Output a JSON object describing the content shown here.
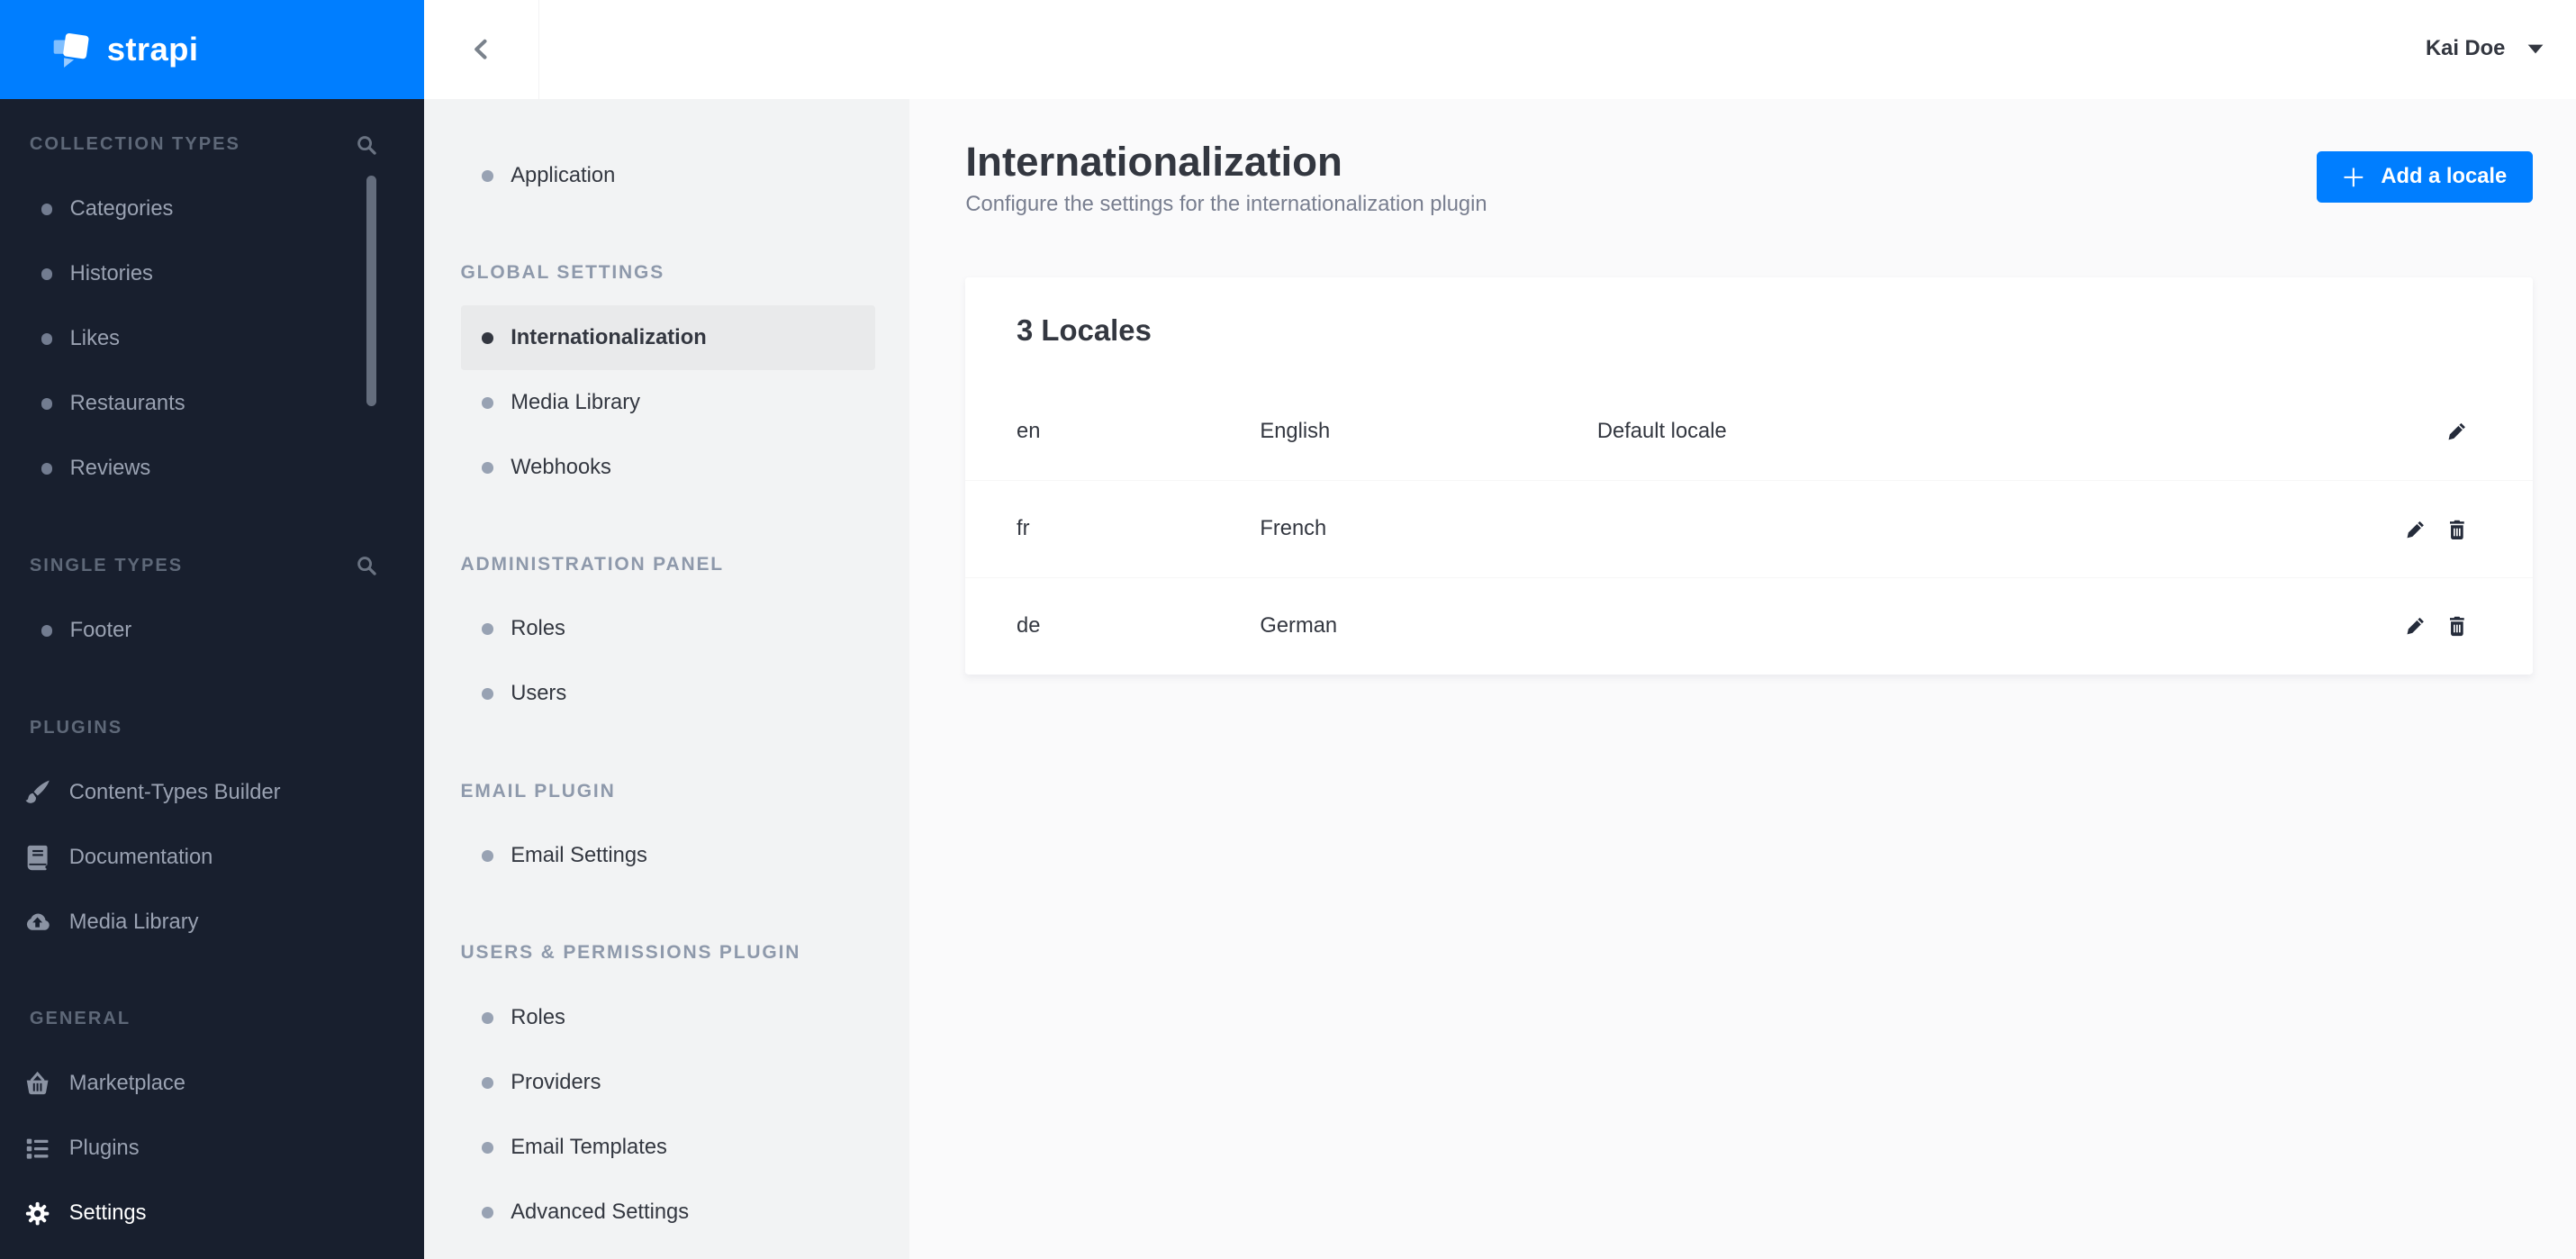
{
  "logo_text": "strapi",
  "user": {
    "name": "Kai Doe"
  },
  "sidebar": {
    "sections": [
      {
        "label": "COLLECTION TYPES",
        "search": true,
        "items": [
          {
            "label": "Categories"
          },
          {
            "label": "Histories"
          },
          {
            "label": "Likes"
          },
          {
            "label": "Restaurants"
          },
          {
            "label": "Reviews"
          }
        ]
      },
      {
        "label": "SINGLE TYPES",
        "search": true,
        "items": [
          {
            "label": "Footer"
          }
        ]
      },
      {
        "label": "PLUGINS",
        "items": [
          {
            "label": "Content-Types Builder",
            "icon": "paint-brush"
          },
          {
            "label": "Documentation",
            "icon": "book"
          },
          {
            "label": "Media Library",
            "icon": "cloud-upload"
          }
        ]
      },
      {
        "label": "GENERAL",
        "items": [
          {
            "label": "Marketplace",
            "icon": "shopping-basket"
          },
          {
            "label": "Plugins",
            "icon": "list"
          },
          {
            "label": "Settings",
            "icon": "gear",
            "active": true
          }
        ]
      }
    ]
  },
  "settings_nav": {
    "groups": [
      {
        "header": "",
        "items": [
          {
            "label": "Application"
          }
        ]
      },
      {
        "header": "GLOBAL SETTINGS",
        "items": [
          {
            "label": "Internationalization",
            "active": true
          },
          {
            "label": "Media Library"
          },
          {
            "label": "Webhooks"
          }
        ]
      },
      {
        "header": "ADMINISTRATION PANEL",
        "items": [
          {
            "label": "Roles"
          },
          {
            "label": "Users"
          }
        ]
      },
      {
        "header": "EMAIL PLUGIN",
        "items": [
          {
            "label": "Email Settings"
          }
        ]
      },
      {
        "header": "USERS & PERMISSIONS PLUGIN",
        "items": [
          {
            "label": "Roles"
          },
          {
            "label": "Providers"
          },
          {
            "label": "Email Templates"
          },
          {
            "label": "Advanced Settings"
          }
        ]
      }
    ]
  },
  "page": {
    "title": "Internationalization",
    "subtitle": "Configure the settings for the internationalization plugin",
    "add_button": "Add a locale",
    "card": {
      "title": "3 Locales",
      "rows": [
        {
          "code": "en",
          "name": "English",
          "note": "Default locale",
          "actions": [
            "edit"
          ]
        },
        {
          "code": "fr",
          "name": "French",
          "note": "",
          "actions": [
            "edit",
            "delete"
          ]
        },
        {
          "code": "de",
          "name": "German",
          "note": "",
          "actions": [
            "edit",
            "delete"
          ]
        }
      ]
    }
  },
  "colors": {
    "primary": "#007eff",
    "sidebar_bg": "#181f2e",
    "panel_bg": "#f2f3f4",
    "content_bg": "#fafafb"
  }
}
